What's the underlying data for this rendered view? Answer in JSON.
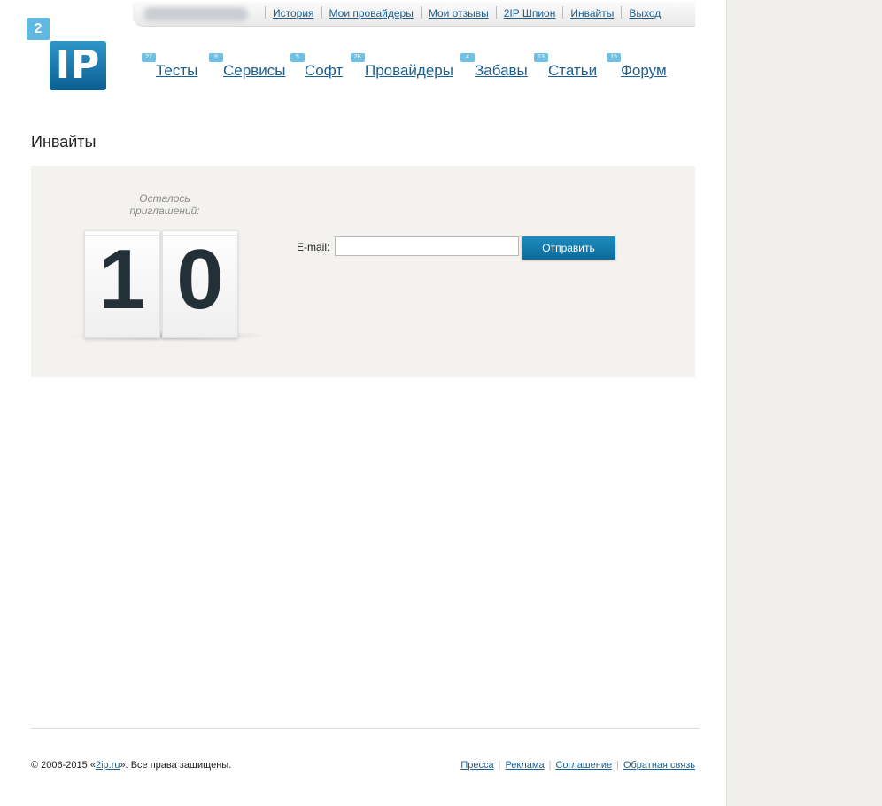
{
  "userbar": {
    "links": [
      "История",
      "Мои провайдеры",
      "Мои отзывы",
      "2IP Шпион",
      "Инвайты",
      "Выход"
    ]
  },
  "logo": {
    "badge": "2",
    "text": "IP"
  },
  "nav": {
    "items": [
      {
        "label": "Тесты",
        "count": "27"
      },
      {
        "label": "Сервисы",
        "count": "9"
      },
      {
        "label": "Софт",
        "count": "5"
      },
      {
        "label": "Провайдеры",
        "count": "2K"
      },
      {
        "label": "Забавы",
        "count": "4"
      },
      {
        "label": "Статьи",
        "count": "13"
      },
      {
        "label": "Форум",
        "count": "15"
      }
    ]
  },
  "page": {
    "title": "Инвайты"
  },
  "invites": {
    "remaining_label": "Осталось приглашений:",
    "digit_1": "1",
    "digit_2": "0",
    "email_label": "E-mail:",
    "email_value": "",
    "submit_label": "Отправить"
  },
  "footer": {
    "copyright_prefix": "© 2006-2015 «",
    "copyright_link": "2ip.ru",
    "copyright_suffix": "». Все права защищены.",
    "links": [
      "Пресса",
      "Реклама",
      "Соглашение",
      "Обратная связь"
    ]
  }
}
